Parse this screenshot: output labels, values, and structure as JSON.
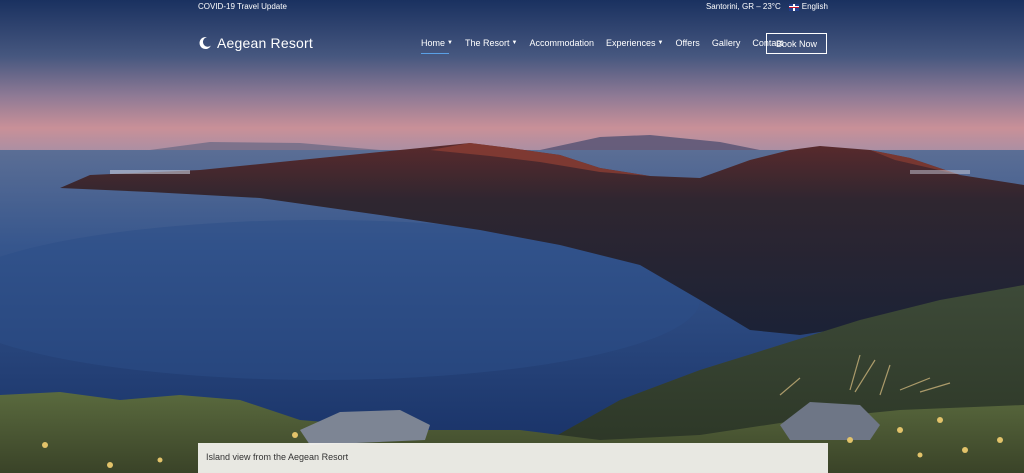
{
  "topbar": {
    "covid_link": "COVID-19 Travel Update",
    "weather": "Santorini, GR – 23°C",
    "language": "English"
  },
  "brand": {
    "name": "Aegean Resort",
    "logo_icon": "crescent-moon-icon"
  },
  "nav": {
    "items": [
      {
        "label": "Home",
        "dropdown": true
      },
      {
        "label": "The Resort",
        "dropdown": true
      },
      {
        "label": "Accommodation",
        "dropdown": false
      },
      {
        "label": "Experiences",
        "dropdown": true
      },
      {
        "label": "Offers",
        "dropdown": false
      },
      {
        "label": "Gallery",
        "dropdown": false
      },
      {
        "label": "Contact",
        "dropdown": false
      }
    ],
    "book_label": "Book Now"
  },
  "hero": {
    "caption": "Island view from the Aegean Resort"
  },
  "colors": {
    "accent": "#5aa0e6",
    "sky_top": "#1d3566",
    "sea": "#203f76"
  }
}
